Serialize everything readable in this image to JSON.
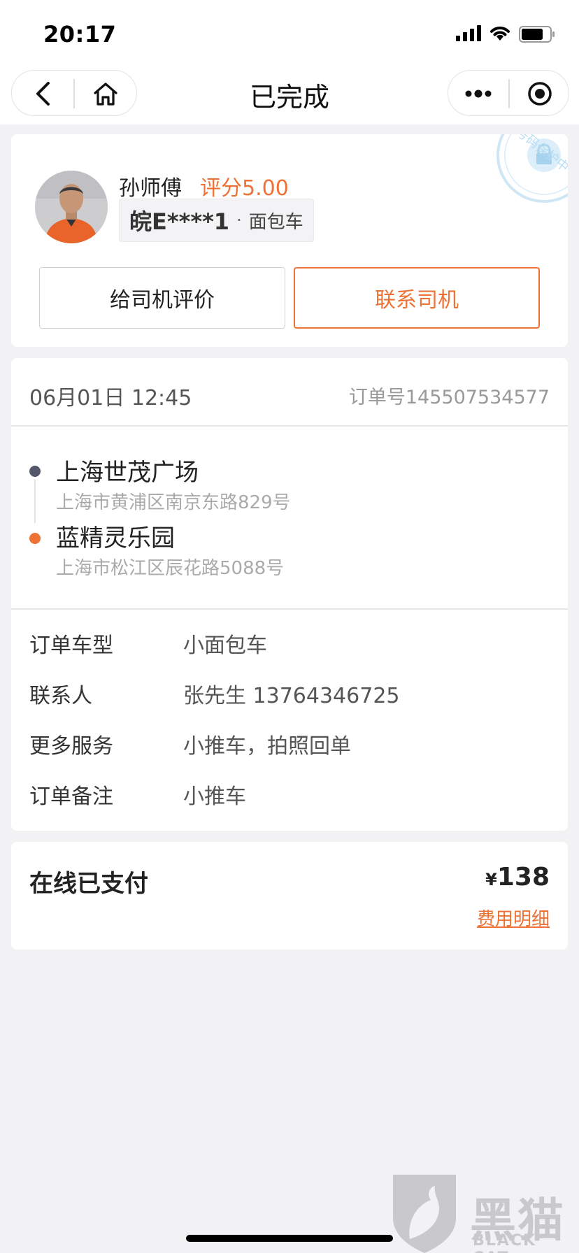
{
  "status_bar": {
    "time": "20:17"
  },
  "nav": {
    "title": "已完成"
  },
  "driver": {
    "name": "孙师傅",
    "rating": "评分5.00",
    "plate": "皖E****1",
    "separator": "·",
    "vehicle": "面包车",
    "stamp_text": "号码保护中",
    "rate_button": "给司机评价",
    "contact_button": "联系司机"
  },
  "order": {
    "date": "06月01日 12:45",
    "number": "订单号145507534577",
    "start": {
      "name": "上海世茂广场",
      "address": "上海市黄浦区南京东路829号"
    },
    "end": {
      "name": "蓝精灵乐园",
      "address": "上海市松江区辰花路5088号"
    },
    "details": [
      {
        "label": "订单车型",
        "value": "小面包车"
      },
      {
        "label": "联系人",
        "value": "张先生 13764346725"
      },
      {
        "label": "更多服务",
        "value": "小推车，拍照回单"
      },
      {
        "label": "订单备注",
        "value": "小推车"
      }
    ]
  },
  "payment": {
    "label": "在线已支付",
    "currency": "¥",
    "amount": "138",
    "fee_detail": "费用明细"
  },
  "watermark": {
    "title": "黑猫",
    "subtitle": "BLACK CAT"
  },
  "colors": {
    "accent": "#ee7235",
    "start_dot": "#55586b",
    "background": "#f2f2f4"
  }
}
